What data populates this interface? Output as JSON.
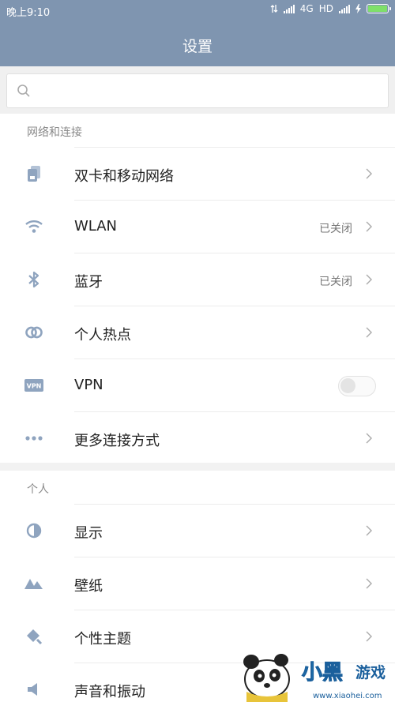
{
  "status_bar": {
    "time": "晚上9:10",
    "network": "4G",
    "hd": "HD"
  },
  "header": {
    "title": "设置"
  },
  "search": {
    "placeholder": ""
  },
  "sections": [
    {
      "title": "网络和连接",
      "items": [
        {
          "label": "双卡和移动网络",
          "value": ""
        },
        {
          "label": "WLAN",
          "value": "已关闭"
        },
        {
          "label": "蓝牙",
          "value": "已关闭"
        },
        {
          "label": "个人热点",
          "value": ""
        },
        {
          "label": "VPN",
          "value": "",
          "toggle": false
        },
        {
          "label": "更多连接方式",
          "value": ""
        }
      ]
    },
    {
      "title": "个人",
      "items": [
        {
          "label": "显示",
          "value": ""
        },
        {
          "label": "壁纸",
          "value": ""
        },
        {
          "label": "个性主题",
          "value": ""
        },
        {
          "label": "声音和振动",
          "value": ""
        }
      ]
    }
  ],
  "icons": {
    "sim": "sim-card-icon",
    "wlan": "wifi-icon",
    "bluetooth": "bluetooth-icon",
    "hotspot": "hotspot-icon",
    "vpn": "vpn-icon",
    "more": "more-dots-icon",
    "display": "display-icon",
    "wallpaper": "wallpaper-icon",
    "theme": "theme-icon",
    "sound": "sound-icon"
  },
  "watermark": {
    "site": "www.xiaohei.com"
  },
  "colors": {
    "header_bg": "#7f95b0",
    "icon": "#8fa4bf",
    "battery": "#7fe06a"
  }
}
